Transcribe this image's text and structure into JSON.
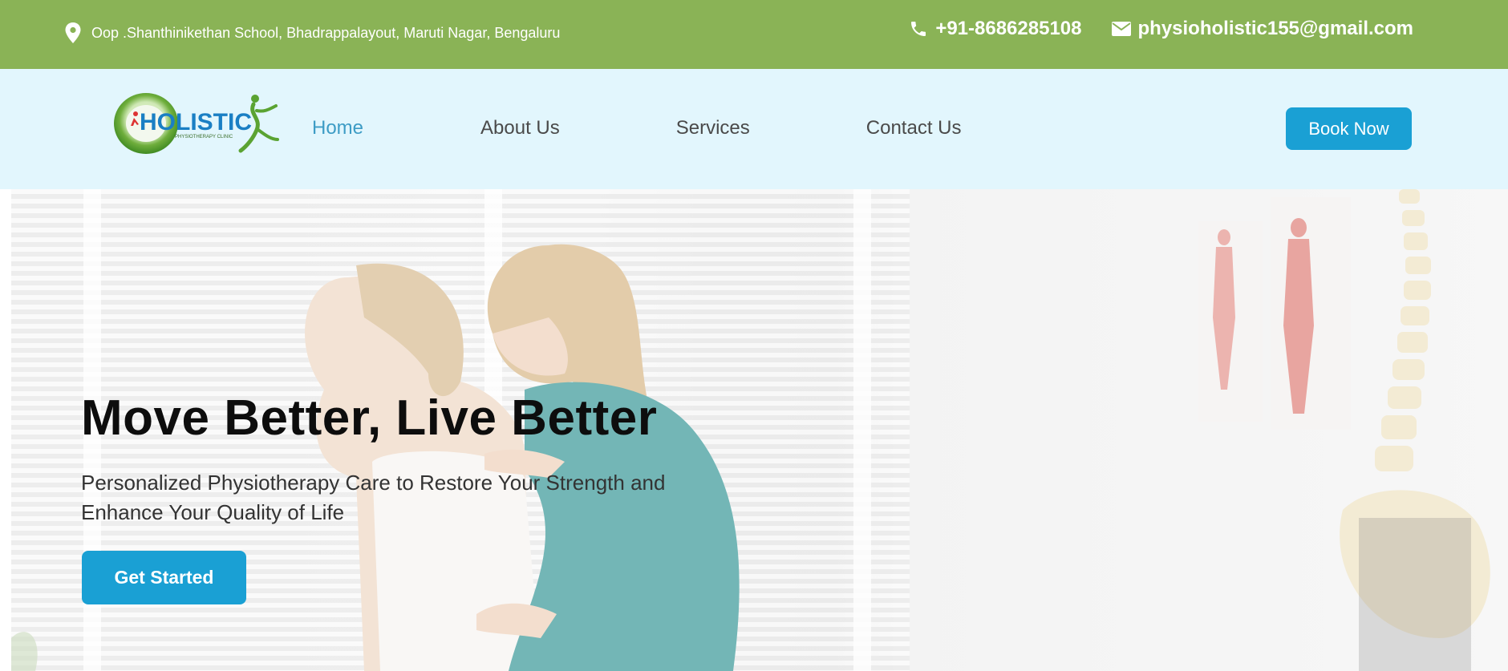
{
  "topbar": {
    "address": "Oop .Shanthinikethan School, Bhadrappalayout, Maruti Nagar, Bengaluru",
    "phone": "+91-8686285108",
    "email": "physioholistic155@gmail.com",
    "icons": {
      "address": "location-pin-icon",
      "phone": "phone-icon",
      "email": "mail-icon"
    }
  },
  "logo": {
    "text": "HOLISTIC",
    "tagline": "PHYSIOTHERAPY CLINIC"
  },
  "nav": {
    "items": [
      {
        "label": "Home",
        "active": true
      },
      {
        "label": "About Us",
        "active": false
      },
      {
        "label": "Services",
        "active": false
      },
      {
        "label": "Contact Us",
        "active": false
      }
    ],
    "book_label": "Book Now"
  },
  "hero": {
    "title": "Move Better, Live Better",
    "subtitle": "Personalized Physiotherapy Care to Restore Your Strength and Enhance Your Quality of Life",
    "cta_label": "Get Started"
  },
  "colors": {
    "topbar": "#8ab356",
    "navbar": "#e2f6fd",
    "accent": "#1aa0d4",
    "active_link": "#3d9cc5"
  }
}
